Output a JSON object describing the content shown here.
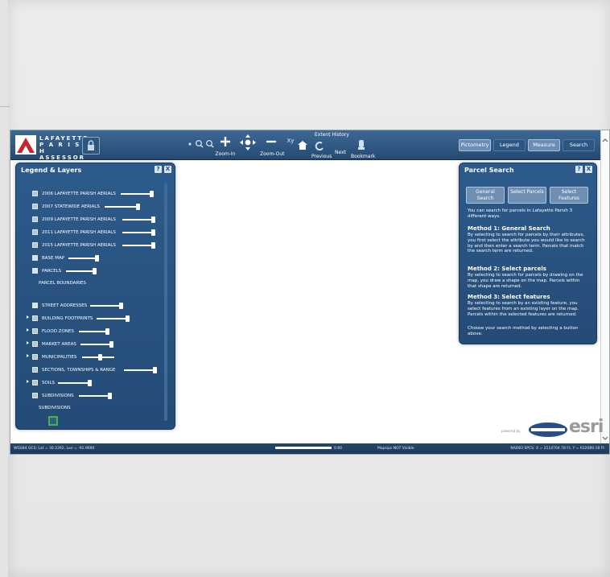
{
  "header": {
    "logo_lines": [
      "LAFAYETTE",
      "P A R I S H",
      "ASSESSOR"
    ],
    "tools": [
      {
        "label": "Zoom-In",
        "icon": "plus-icon"
      },
      {
        "label": "",
        "icon": "pan-icon"
      },
      {
        "label": "Zoom-Out",
        "icon": "minus-icon"
      },
      {
        "label": "",
        "icon": "xy-icon"
      },
      {
        "label": "",
        "icon": "home-icon"
      },
      {
        "label": "Previous",
        "icon": "previous-icon"
      },
      {
        "label": "Next",
        "icon": "next-icon"
      },
      {
        "label": "Bookmark",
        "icon": "bookmark-icon"
      }
    ],
    "extent_history": "Extent History",
    "right_buttons": [
      "Pictometry",
      "Legend",
      "Measure",
      "Search"
    ]
  },
  "legend": {
    "title": "Legend & Layers",
    "help": "?",
    "close": "X",
    "layers": [
      "2006 LAFAYETTE PARISH AERIALS",
      "2007 STATEWIDE AERIALS",
      "2009 LAFAYETTE PARISH AERIALS",
      "2011 LAFAYETTE PARISH AERIALS",
      "2015 LAFAYETTE PARISH AERIALS",
      "BASE MAP",
      "PARCELS",
      "PARCEL BOUNDARIES",
      "STREET ADDRESSES",
      "BUILDING FOOTPRINTS",
      "FLOOD ZONES",
      "MARKET AREAS",
      "MUNICIPALITIES",
      "SECTIONS, TOWNSHIPS & RANGE",
      "SOILS",
      "SUBDIVISIONS",
      "SUBDIVISIONS"
    ]
  },
  "parcel_search": {
    "title": "Parcel Search",
    "help": "?",
    "close": "X",
    "buttons": [
      "General Search",
      "Select Parcels",
      "Select Features"
    ],
    "intro": "You can search for parcels in Lafayette Parish 3 different ways.",
    "m1_title": "Method 1: General Search",
    "m1_text": "By selecting to search for parcels by their attributes, you first select the attribute you would like to search by and then enter a search term. Parcels that match the search term are returned.",
    "m2_title": "Method 2: Select parcels",
    "m2_text": "By selecting to search for parcels by drawing on the map, you draw a shape on the map. Parcels within that shape are returned.",
    "m3_title": "Method 3: Select features",
    "m3_text": "By selecting to search by an existing feature, you select features from an existing layer on the map. Parcels within the selected features are returned.",
    "footer": "Choose your search method by selecting a button above."
  },
  "status": {
    "left": "WGS84 GCS: Lat = 30.2392, Lon = -91.9690",
    "scale": "0.60",
    "center": "Mapsips NOT Visible",
    "right": "NAD83 SPCS: X = 2114704.78 Ft, Y = 632089.18 Ft"
  },
  "brand": {
    "esri": "esri",
    "powered": "powered by"
  },
  "colors": {
    "header": "#2f5a88",
    "panel": "#2b5685",
    "accent_swatch": "#4caf50"
  }
}
